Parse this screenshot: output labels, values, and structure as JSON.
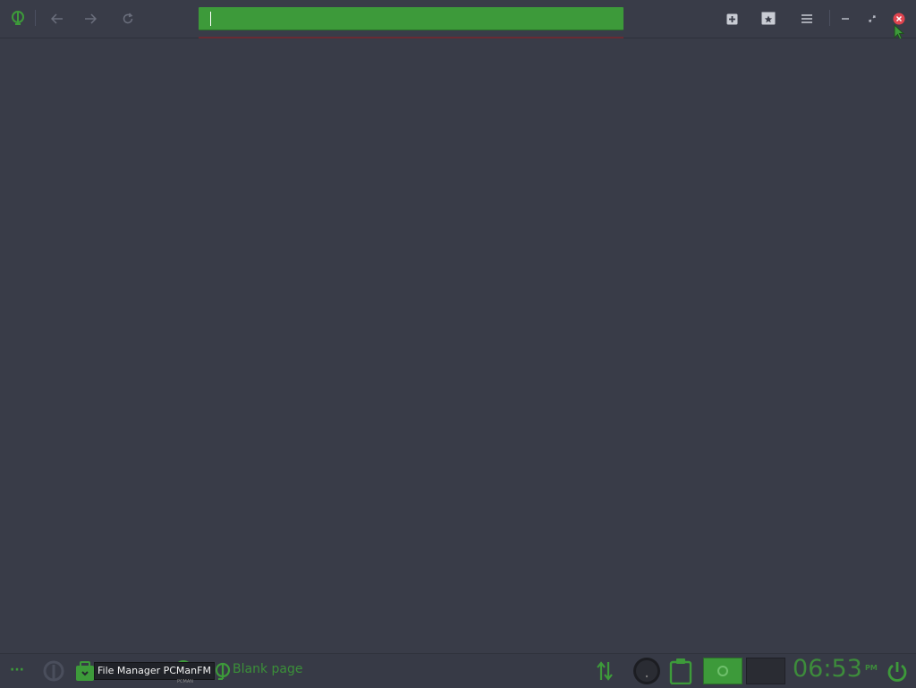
{
  "browser": {
    "url_value": "",
    "buttons": {
      "home": "home-icon",
      "back": "back-arrow-icon",
      "forward": "forward-arrow-icon",
      "reload": "reload-icon",
      "new_tab": "plus-square-icon",
      "bookmarks": "star-bookmark-icon",
      "menu": "hamburger-menu-icon",
      "minimize": "minimize-icon",
      "maximize": "restore-icon",
      "close": "close-icon"
    },
    "colors": {
      "accent": "#3d9a3a",
      "background": "#393c48",
      "close": "#e0444f"
    }
  },
  "taskbar": {
    "tooltip": "File Manager PCManFM",
    "tooltip_sub": "PCMAN",
    "active_task_label": "Blank page",
    "clock_time": "06:53",
    "clock_ampm": "PM",
    "menu_dots": "···"
  }
}
